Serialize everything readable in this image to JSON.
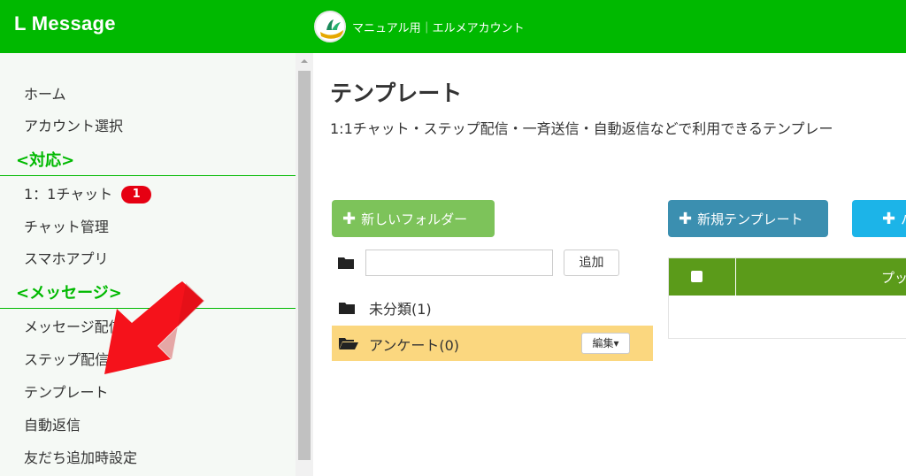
{
  "header": {
    "brand": "L Message",
    "account_name": "マニュアル用｜エルメアカウント",
    "colors": {
      "brand": "#00b900",
      "badge": "#e60012"
    }
  },
  "sidebar": {
    "items": [
      {
        "label": "ホーム"
      },
      {
        "label": "アカウント選択"
      },
      {
        "label": "1：1チャット",
        "badge": "1"
      },
      {
        "label": "チャット管理"
      },
      {
        "label": "スマホアプリ"
      },
      {
        "label": "メッセージ配信"
      },
      {
        "label": "ステップ配信"
      },
      {
        "label": "テンプレート"
      },
      {
        "label": "自動返信"
      },
      {
        "label": "友だち追加時設定"
      }
    ],
    "sections": [
      {
        "label": "<対応>"
      },
      {
        "label": "<メッセージ>"
      }
    ]
  },
  "main": {
    "title": "テンプレート",
    "description": "1:1チャット・ステップ配信・一斉送信・自動返信などで利用できるテンプレー",
    "buttons": {
      "new_folder": "新しいフォルダー",
      "new_template": "新規テンプレート",
      "third": "パ",
      "plus": "✚"
    },
    "folder_input": {
      "value": "",
      "placeholder": ""
    },
    "add_label": "追加",
    "folders": [
      {
        "label": "未分類(1)"
      },
      {
        "label": "アンケート(0)",
        "edit_label": "編集▾"
      }
    ],
    "table": {
      "column": "プッ"
    }
  }
}
